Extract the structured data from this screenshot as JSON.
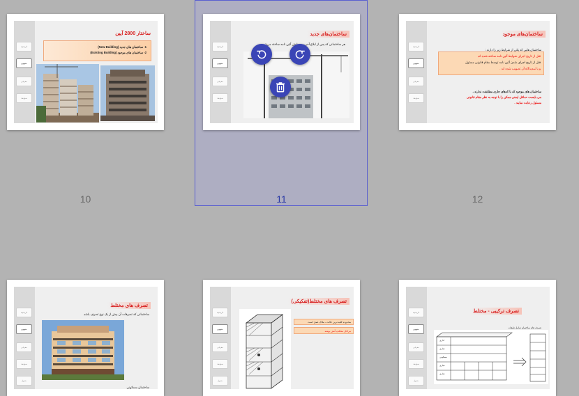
{
  "pages": {
    "p10": {
      "number": "10",
      "title": "ساختار 2800 آیین",
      "items": [
        "1- ساختمان های جدید (New Building)",
        "2- ساختمان های موجود (Existing Building)"
      ],
      "sidebar": [
        "تاریخچه",
        "مفهوم",
        "معرفی",
        "ضوابط"
      ]
    },
    "p11": {
      "number": "11",
      "title": "ساختمان‌های جدید",
      "body": "هر ساختمانی که پس از ابلاغ آخرین ویرایش آئین نامه ساخته می‌شود .",
      "sidebar": [
        "تاریخچه",
        "مفهوم",
        "معرفی",
        "ضوابط"
      ]
    },
    "p12": {
      "number": "12",
      "title": "ساختمان‌های موجود",
      "intro": "ساختمان هایی که یکی از شرایط زیر را دارند :",
      "b1": "قبل از تاریخ اجرای ضوابط آئین نامه ساخته شده اند",
      "b2": "قبل از تاریخ اجرای شدن آئین نامه توسط مقام قانونی مسئول",
      "b3": "و یا تمدیدگاه آن تصویب شده اند .",
      "p1": "ساختمان های موجود که با کدهای جاری مطابقت ندارند ،",
      "p2": "می بایست حداقل ایمنی ممکن را با توجه به نظر مقام قانونی",
      "p3": "مسئول رعایت نمایند .",
      "sidebar": [
        "تاریخچه",
        "مفهوم",
        "معرفی",
        "ضوابط"
      ]
    },
    "p13": {
      "title": "تصرف های مختلط",
      "sub": "ساختمانی که تصرفات آن بیش از یک نوع تصرف باشد",
      "caption": "ساختمان مسکونی",
      "sidebar": [
        "تاریخچه",
        "مفهوم",
        "معرفی",
        "ضوابط",
        "جدول"
      ]
    },
    "p14": {
      "title": "تصرف های مختلط(تفکیکی)",
      "box1": "محدوده کلیه ترین حالت ، ملاک عمل است",
      "box2": "مراحل مختلف آتش بوشه",
      "sidebar": [
        "تاریخچه",
        "مفهوم",
        "معرفی",
        "ضوابط",
        "جدول"
      ]
    },
    "p15": {
      "title": "تصرف ترکیبی - مختلط",
      "table_header": "تصرف های ساختمان شامل طبقات",
      "rows": [
        "اداری",
        "تجاری",
        "مسکونی",
        "تجاری",
        "تجاری"
      ],
      "sidebar": [
        "تاریخچه",
        "مفهوم",
        "معرفی",
        "ضوابط",
        "جدول"
      ]
    }
  },
  "actions": {
    "rotate_left": "rotate-left-icon",
    "rotate_right": "rotate-right-icon",
    "delete": "trash-icon"
  },
  "colors": {
    "background": "#b3b3b3",
    "selection": "#5a5fd0",
    "action": "#3a45b6",
    "title_red": "#d81e1e"
  }
}
